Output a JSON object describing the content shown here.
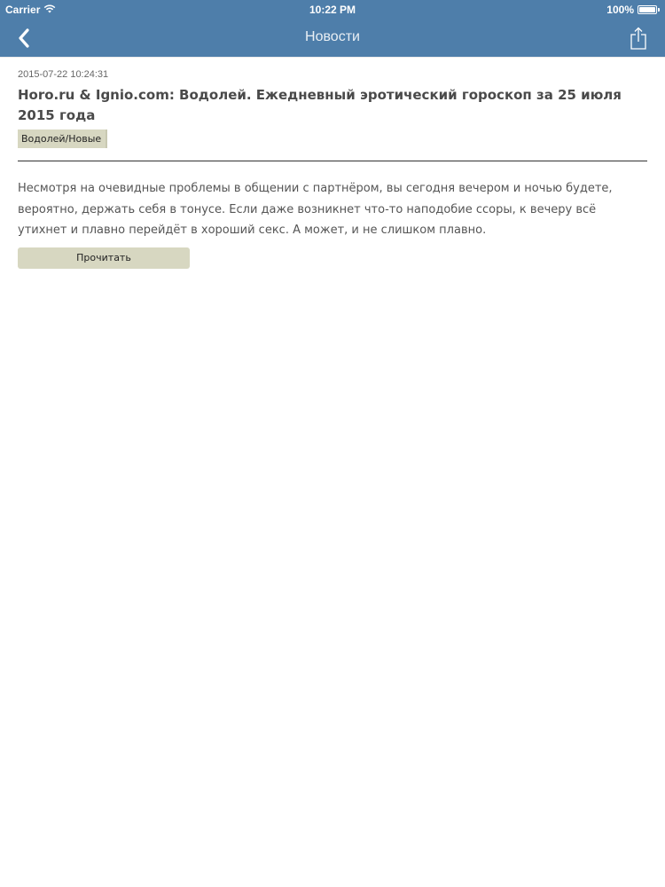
{
  "status_bar": {
    "carrier": "Carrier",
    "time": "10:22 PM",
    "battery": "100%",
    "battery_level": 1.0
  },
  "nav": {
    "title": "Новости",
    "back_icon": "chevron-left-icon",
    "share_icon": "share-icon"
  },
  "article": {
    "date": "2015-07-22 10:24:31",
    "title": "Horo.ru & Ignio.com: Водолей. Ежедневный эротический гороскоп за 25 июля 2015 года",
    "tag": "Водолей/Новые",
    "body": "Несмотря на очевидные проблемы в общении с партнёром, вы сегодня вечером и ночью будете, вероятно, держать себя в тонусе. Если даже возникнет что-то наподобие ссоры, к вечеру всё утихнет и плавно перейдёт в хороший секс. А может, и не слишком плавно.",
    "read_button": "Прочитать"
  },
  "colors": {
    "bar": "#4e7eaa",
    "tag_bg": "#d7d7c1",
    "text": "#555555"
  }
}
